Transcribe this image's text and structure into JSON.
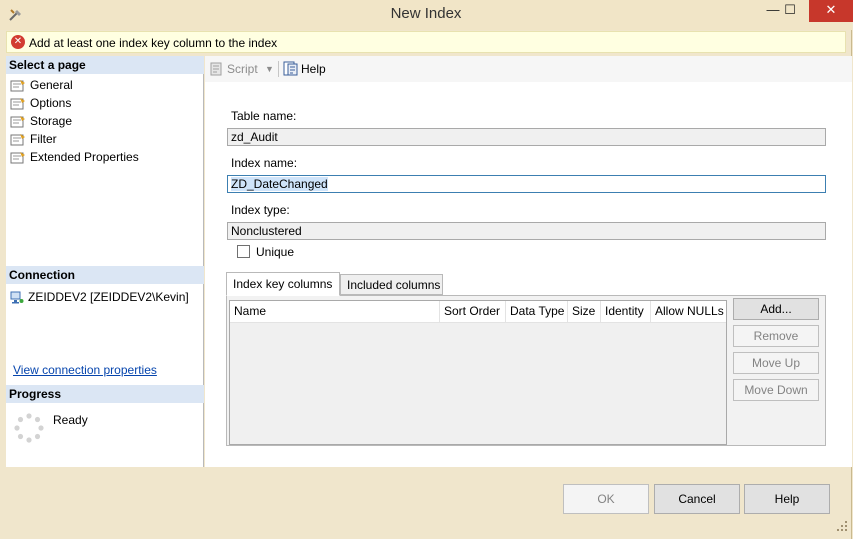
{
  "window": {
    "title": "New Index",
    "minimize_glyph": "—",
    "maximize_glyph": "☐",
    "close_glyph": "✕"
  },
  "error": {
    "message": "Add at least one index key column to the index"
  },
  "left": {
    "select_page_header": "Select a page",
    "pages": [
      "General",
      "Options",
      "Storage",
      "Filter",
      "Extended Properties"
    ],
    "connection_header": "Connection",
    "connection_text": "ZEIDDEV2 [ZEIDDEV2\\Kevin]",
    "view_connection_link": "View connection properties",
    "progress_header": "Progress",
    "progress_status": "Ready"
  },
  "toolbar": {
    "script_label": "Script",
    "dropdown_glyph": "▼",
    "help_label": "Help"
  },
  "form": {
    "table_name_label": "Table name:",
    "table_name_value": "zd_Audit",
    "index_name_label": "Index name:",
    "index_name_value": "ZD_DateChanged",
    "index_type_label": "Index type:",
    "index_type_value": "Nonclustered",
    "unique_label": "Unique",
    "unique_checked": false
  },
  "tabs": [
    "Index key columns",
    "Included columns"
  ],
  "grid": {
    "columns": [
      "Name",
      "Sort Order",
      "Data Type",
      "Size",
      "Identity",
      "Allow NULLs"
    ],
    "rows": []
  },
  "side_buttons": {
    "add": "Add...",
    "remove": "Remove",
    "move_up": "Move Up",
    "move_down": "Move Down"
  },
  "footer": {
    "ok": "OK",
    "cancel": "Cancel",
    "help": "Help"
  },
  "colors": {
    "window_frame": "#f0e6cc",
    "error_bar": "#ffffe1",
    "section_header": "#dbe6f4",
    "close_button": "#c7372b",
    "link": "#0645ad",
    "selection": "#cfe4fa"
  },
  "icons": {
    "app": "tools-icon",
    "error": "error-icon",
    "page": "page-icon",
    "connection": "server-icon",
    "script": "script-icon",
    "help": "help-icon",
    "progress": "spinner-icon"
  }
}
